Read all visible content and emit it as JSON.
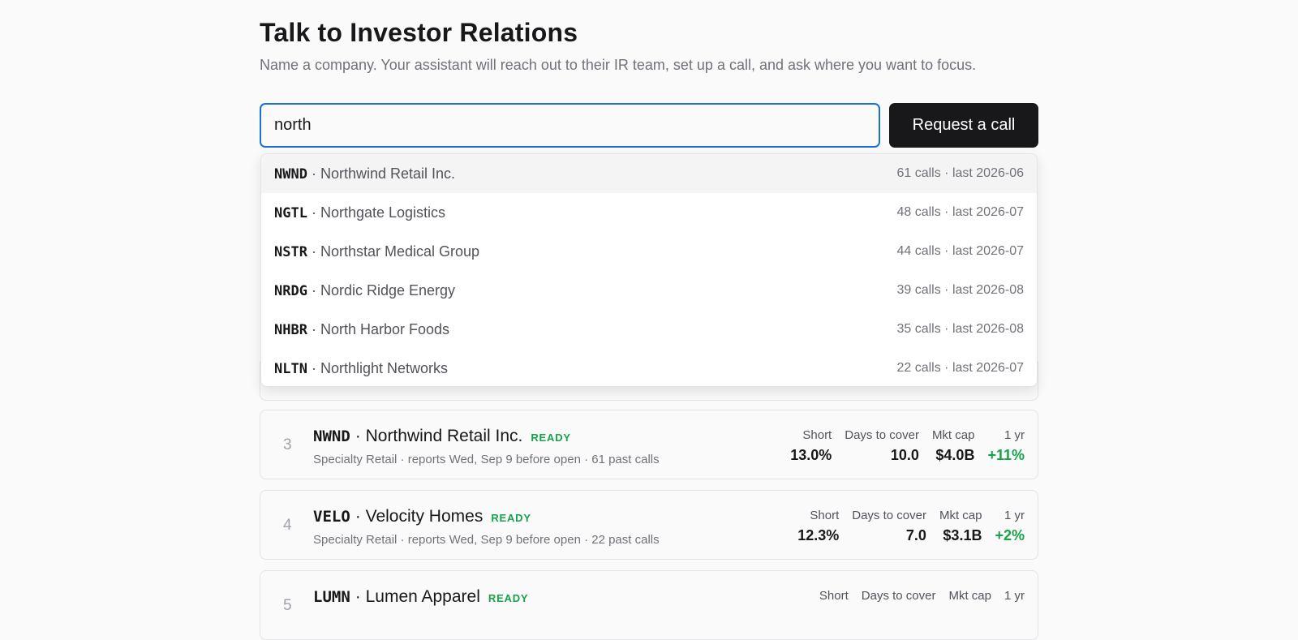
{
  "header": {
    "title": "Talk to Investor Relations",
    "subtitle": "Name a company. Your assistant will reach out to their IR team, set up a call, and ask where you want to focus."
  },
  "search": {
    "value": "north",
    "button_label": "Request a call"
  },
  "dropdown": [
    {
      "ticker": "NWND",
      "sep": " · ",
      "name": "Northwind Retail Inc.",
      "meta": "61 calls · last 2026-06"
    },
    {
      "ticker": "NGTL",
      "sep": " · ",
      "name": "Northgate Logistics",
      "meta": "48 calls · last 2026-07"
    },
    {
      "ticker": "NSTR",
      "sep": " · ",
      "name": "Northstar Medical Group",
      "meta": "44 calls · last 2026-07"
    },
    {
      "ticker": "NRDG",
      "sep": " · ",
      "name": "Nordic Ridge Energy",
      "meta": "39 calls · last 2026-08"
    },
    {
      "ticker": "NHBR",
      "sep": " · ",
      "name": "North Harbor Foods",
      "meta": "35 calls · last 2026-08"
    },
    {
      "ticker": "NLTN",
      "sep": " · ",
      "name": "Northlight Networks",
      "meta": "22 calls · last 2026-07"
    }
  ],
  "labels": {
    "short": "Short",
    "days": "Days to cover",
    "mktcap": "Mkt cap",
    "yr": "1 yr"
  },
  "cards": [
    {
      "rank": "3",
      "ticker": "NWND",
      "name": "· Northwind Retail Inc.",
      "badge": "READY",
      "sub": "Specialty Retail · reports Wed, Sep 9 before open · 61 past calls",
      "short": "13.0%",
      "days": "10.0",
      "mktcap": "$4.0B",
      "yr": "+11%"
    },
    {
      "rank": "4",
      "ticker": "VELO",
      "name": "· Velocity Homes",
      "badge": "READY",
      "sub": "Specialty Retail · reports Wed, Sep 9 before open · 22 past calls",
      "short": "12.3%",
      "days": "7.0",
      "mktcap": "$3.1B",
      "yr": "+2%"
    },
    {
      "rank": "5",
      "ticker": "LUMN",
      "name": "· Lumen Apparel",
      "badge": "READY",
      "sub": "",
      "short": "",
      "days": "",
      "mktcap": "",
      "yr": ""
    }
  ],
  "colors": {
    "accent": "#1d6fd8",
    "positive": "#16a34a",
    "button_bg": "#18181b"
  }
}
